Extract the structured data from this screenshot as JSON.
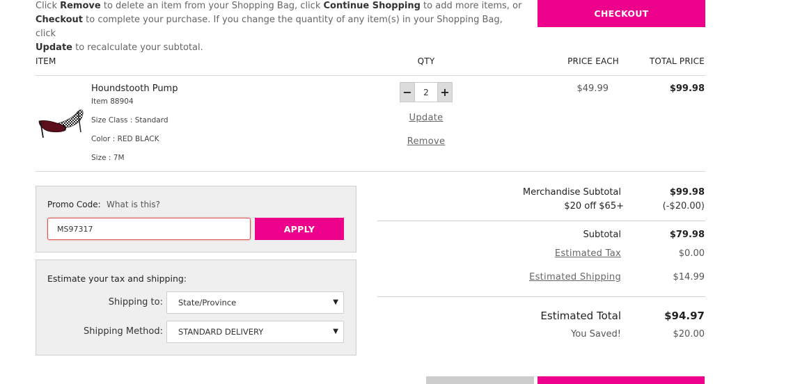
{
  "instructions": {
    "t1": "Click ",
    "b1": "Remove",
    "t2": " to delete an item from your Shopping Bag, click ",
    "b2": "Continue Shopping",
    "t3": " to add more items, or ",
    "b3": "Checkout",
    "t4": " to complete your purchase. If you change the quantity of any item(s) in your Shopping Bag, click ",
    "b4": "Update",
    "t5": " to recalculate your subtotal."
  },
  "checkout_label": "CHECKOUT",
  "table_headers": {
    "item": "ITEM",
    "qty": "QTY",
    "price_each": "PRICE EACH",
    "total_price": "TOTAL PRICE"
  },
  "item": {
    "name": "Houndstooth Pump",
    "number": "Item 88904",
    "size_class": "Size Class : Standard",
    "color": "Color : RED BLACK",
    "size": "Size : 7M",
    "qty": "2",
    "minus": "−",
    "plus": "+",
    "update_label": "Update",
    "remove_label": "Remove",
    "price_each": "$49.99",
    "total_price": "$99.98"
  },
  "promo": {
    "label": "Promo Code:",
    "help": "What is this?",
    "value": "MS97317",
    "apply_label": "APPLY"
  },
  "tax": {
    "title": "Estimate your tax and shipping:",
    "shipping_to_label": "Shipping to:",
    "shipping_to_value": "State/Province",
    "method_label": "Shipping Method:",
    "method_value": "STANDARD DELIVERY",
    "caret": "▼"
  },
  "summary": {
    "merch_label": "Merchandise Subtotal",
    "merch_value": "$99.98",
    "discount_label": "$20 off $65+",
    "discount_value": "(-$20.00)",
    "subtotal_label": "Subtotal",
    "subtotal_value": "$79.98",
    "tax_label": "Estimated Tax",
    "tax_value": "$0.00",
    "shipping_label": "Estimated Shipping",
    "shipping_value": "$14.99",
    "total_label": "Estimated Total",
    "total_value": "$94.97",
    "saved_label": "You Saved!",
    "saved_value": "$20.00"
  },
  "colors": {
    "accent": "#ec008c",
    "panel_bg": "#efefef",
    "error_border": "#d9534f"
  }
}
